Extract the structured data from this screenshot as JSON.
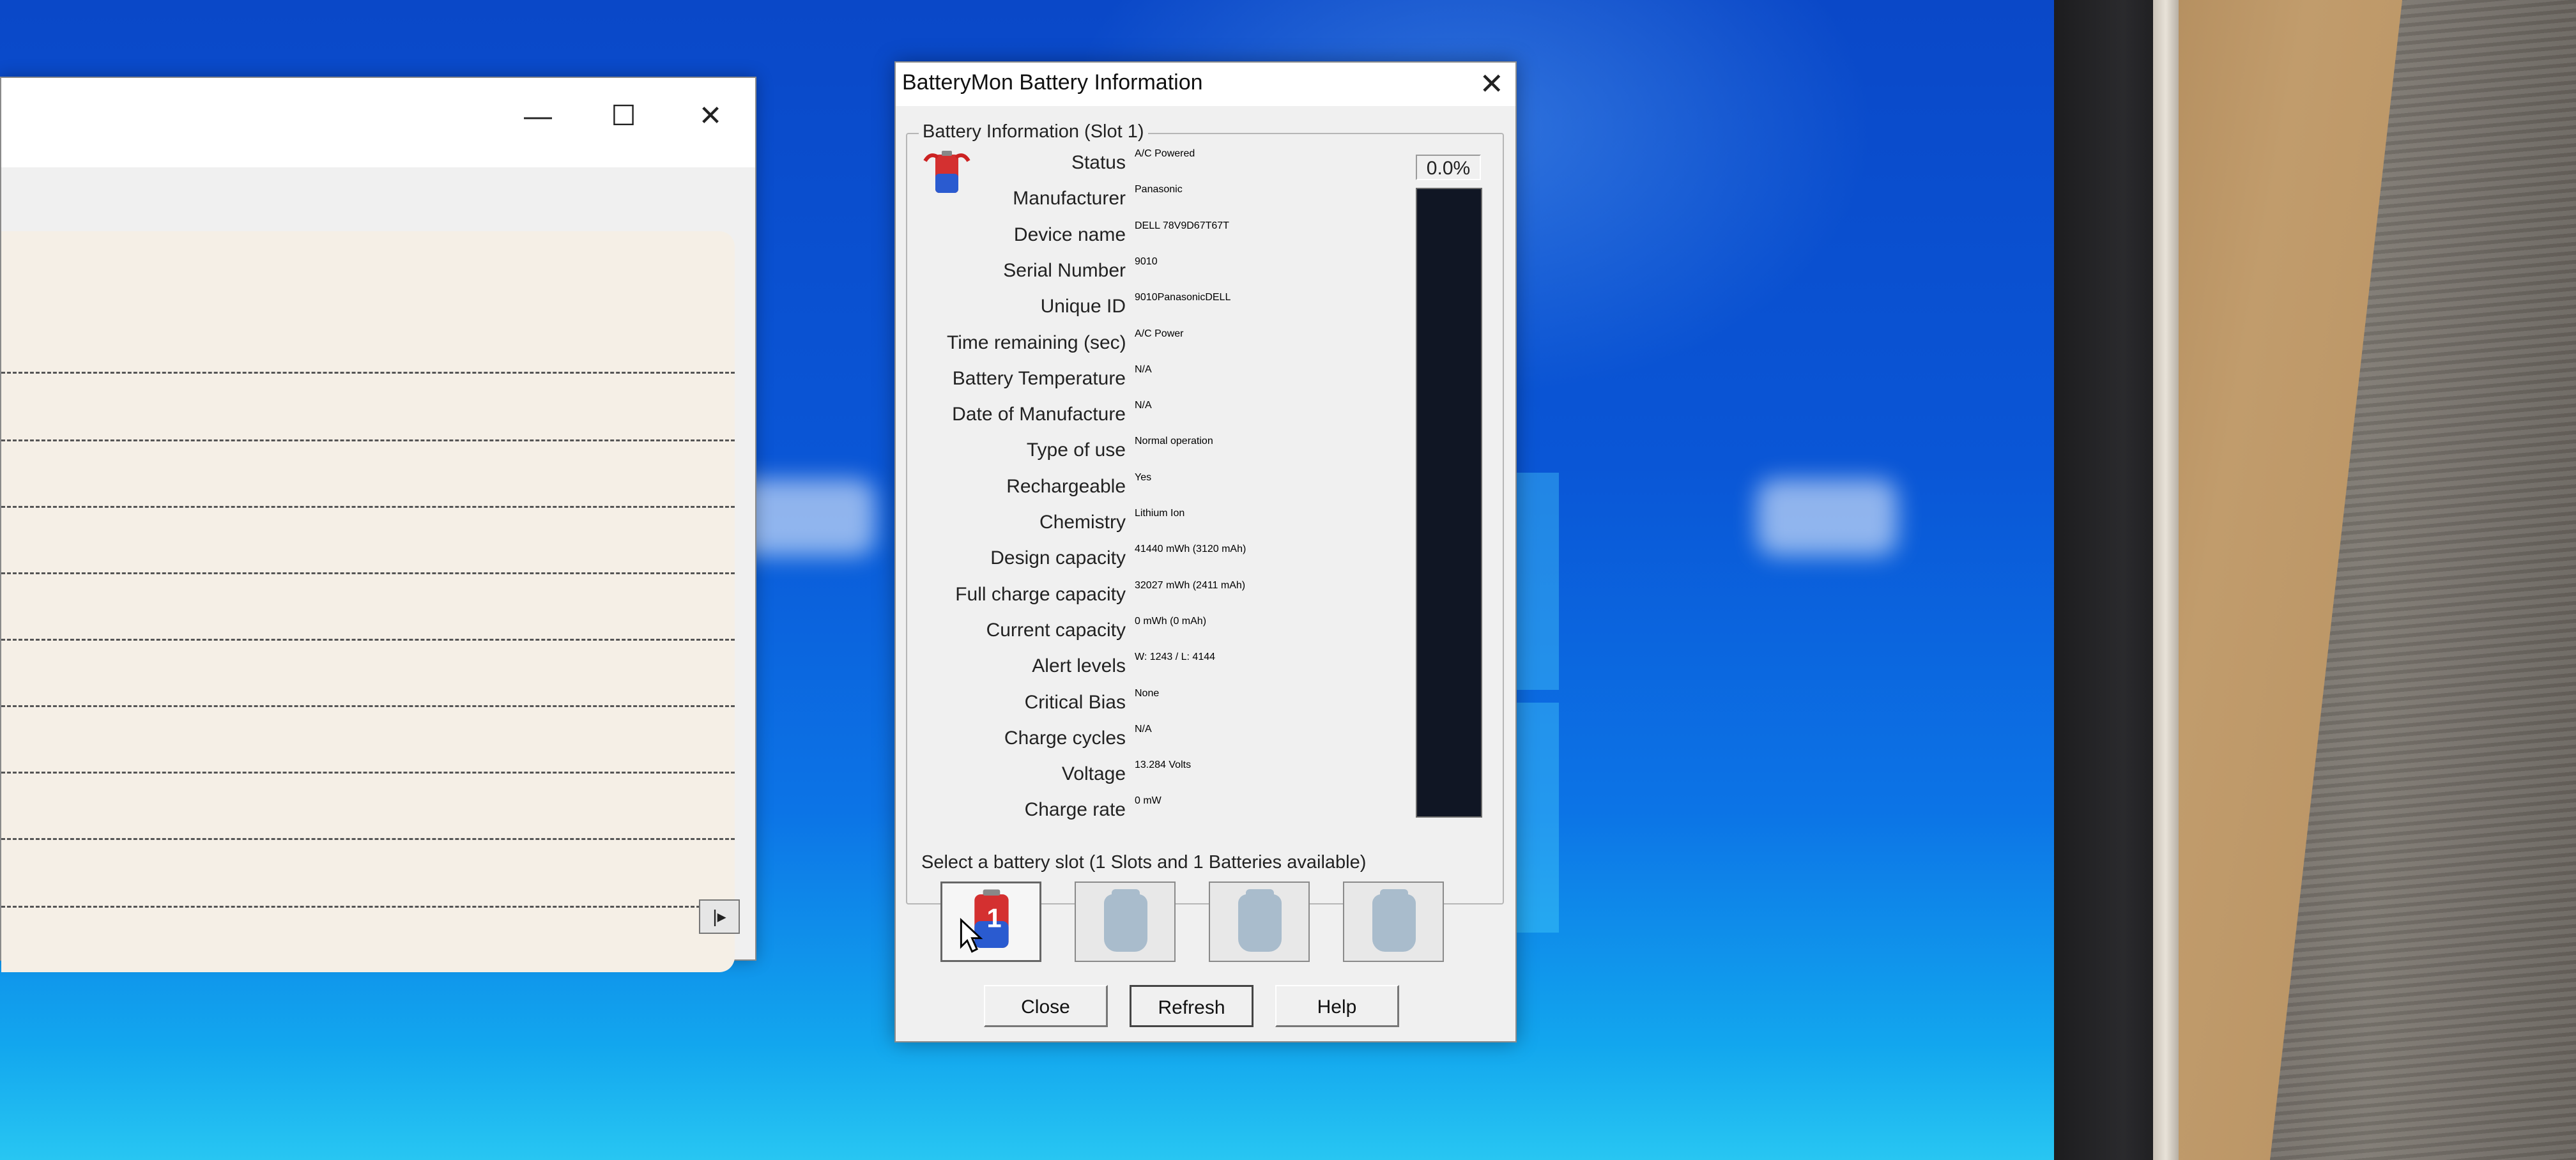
{
  "background_window": {
    "minimize_icon": "minimize-icon",
    "maximize_icon": "maximize-icon",
    "close_icon": "close-icon",
    "scroll_glyph": "|▸"
  },
  "dialog": {
    "title": "BatteryMon Battery Information",
    "close_glyph": "✕",
    "info_group_label": "Battery Information (Slot 1)",
    "charge_percent": "0.0%",
    "charge_level": 0.0,
    "fields": [
      {
        "label": "Status",
        "value": "A/C Powered"
      },
      {
        "label": "Manufacturer",
        "value": "Panasonic"
      },
      {
        "label": "Device name",
        "value": "DELL 78V9D67T67T"
      },
      {
        "label": "Serial Number",
        "value": "9010"
      },
      {
        "label": "Unique ID",
        "value": "9010PanasonicDELL"
      },
      {
        "label": "Time remaining (sec)",
        "value": "A/C Power"
      },
      {
        "label": "Battery Temperature",
        "value": "N/A"
      },
      {
        "label": "Date of Manufacture",
        "value": "N/A"
      },
      {
        "label": "Type of use",
        "value": "Normal operation"
      },
      {
        "label": "Rechargeable",
        "value": "Yes"
      },
      {
        "label": "Chemistry",
        "value": "Lithium Ion"
      },
      {
        "label": "Design capacity",
        "value": "41440 mWh (3120 mAh)"
      },
      {
        "label": "Full charge capacity",
        "value": "32027 mWh (2411 mAh)"
      },
      {
        "label": "Current capacity",
        "value": "0 mWh (0 mAh)"
      },
      {
        "label": "Alert levels",
        "value": "W: 1243 / L: 4144"
      },
      {
        "label": "Critical Bias",
        "value": "None"
      },
      {
        "label": "Charge cycles",
        "value": "N/A"
      },
      {
        "label": "Voltage",
        "value": "13.284 Volts"
      },
      {
        "label": "Charge rate",
        "value": "0 mW"
      }
    ],
    "slot_group_label": "Select a battery slot (1 Slots and 1 Batteries available)",
    "slots": [
      {
        "name": "battery-slot-1",
        "active": true,
        "label": "1"
      },
      {
        "name": "battery-slot-2",
        "active": false
      },
      {
        "name": "battery-slot-3",
        "active": false
      },
      {
        "name": "battery-slot-4",
        "active": false
      }
    ],
    "buttons": {
      "close": "Close",
      "refresh": "Refresh",
      "help": "Help"
    }
  }
}
